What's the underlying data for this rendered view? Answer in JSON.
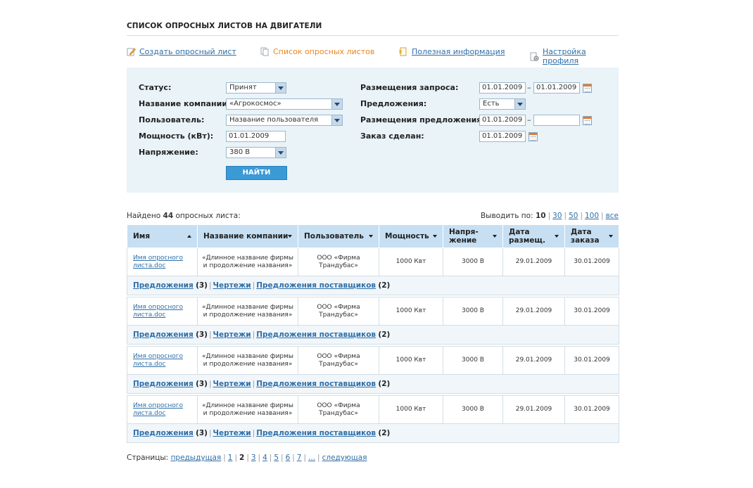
{
  "page_title": "СПИСОК ОПРОСНЫХ ЛИСТОВ НА ДВИГАТЕЛИ",
  "nav": [
    {
      "label": "Создать опросный лист",
      "icon": "pencil-icon",
      "active": false
    },
    {
      "label": "Список опросных листов",
      "icon": "documents-icon",
      "active": true
    },
    {
      "label": "Полезная информация",
      "icon": "info-doc-icon",
      "active": false
    },
    {
      "label": "Настройка профиля",
      "icon": "settings-doc-icon",
      "active": false
    }
  ],
  "filters": {
    "status_label": "Статус:",
    "status_value": "Принят",
    "company_label": "Название компании:",
    "company_value": "«Агрокосмос»",
    "user_label": "Пользователь:",
    "user_value": "Название пользователя",
    "power_label": "Мощность (кВт):",
    "power_value": "01.01.2009",
    "voltage_label": "Напряжение:",
    "voltage_value": "380 В",
    "request_date_label": "Размещения запроса:",
    "request_from": "01.01.2009",
    "request_dash": "–",
    "request_to": "01.01.2009",
    "offers_label": "Предложения:",
    "offers_value": "Есть",
    "offer_date_label": "Размещения предложения:",
    "offer_from": "01.01.2009",
    "offer_dash": "–",
    "offer_to": "",
    "order_label": "Заказ сделан:",
    "order_value": "01.01.2009",
    "search_button": "НАЙТИ"
  },
  "results": {
    "found_prefix": "Найдено",
    "found_count": "44",
    "found_suffix": "опросных листа:",
    "per_page_label": "Выводить по:",
    "per_page_current": "10",
    "per_page_options": [
      "30",
      "50",
      "100",
      "все"
    ]
  },
  "table": {
    "headers": [
      "Имя",
      "Название компании",
      "Пользователь",
      "Мощность",
      "Напря-жение",
      "Дата размещ.",
      "Дата заказа"
    ],
    "header_lines": [
      [
        "Имя"
      ],
      [
        "Название компании"
      ],
      [
        "Пользователь"
      ],
      [
        "Мощность"
      ],
      [
        "Напря-",
        "жение"
      ],
      [
        "Дата",
        "размещ."
      ],
      [
        "Дата",
        "заказа"
      ]
    ],
    "rows": [
      {
        "name": "Имя опросного листа.doc",
        "company": "«Длинное название фирмы и продолжение названия»",
        "user": "ООО «Фирма Трандубас»",
        "power": "1000 Квт",
        "voltage": "3000 В",
        "placed": "29.01.2009",
        "ordered": "30.01.2009",
        "offers_label": "Предложения",
        "offers_count": "(3)",
        "drawings_label": "Чертежи",
        "suppliers_label": "Предложения поставщиков",
        "suppliers_count": "(2)"
      },
      {
        "name": "Имя опросного листа.doc",
        "company": "«Длинное название фирмы и продолжение названия»",
        "user": "ООО «Фирма Трандубас»",
        "power": "1000 Квт",
        "voltage": "3000 В",
        "placed": "29.01.2009",
        "ordered": "30.01.2009",
        "offers_label": "Предложения",
        "offers_count": "(3)",
        "drawings_label": "Чертежи",
        "suppliers_label": "Предложения поставщиков",
        "suppliers_count": "(2)"
      },
      {
        "name": "Имя опросного листа.doc",
        "company": "«Длинное название фирмы и продолжение названия»",
        "user": "ООО «Фирма Трандубас»",
        "power": "1000 Квт",
        "voltage": "3000 В",
        "placed": "29.01.2009",
        "ordered": "30.01.2009",
        "offers_label": "Предложения",
        "offers_count": "(3)",
        "drawings_label": "Чертежи",
        "suppliers_label": "Предложения поставщиков",
        "suppliers_count": "(2)"
      },
      {
        "name": "Имя опросного листа.doc",
        "company": "«Длинное название фирмы и продолжение названия»",
        "user": "ООО «Фирма Трандубас»",
        "power": "1000 Квт",
        "voltage": "3000 В",
        "placed": "29.01.2009",
        "ordered": "30.01.2009",
        "offers_label": "Предложения",
        "offers_count": "(3)",
        "drawings_label": "Чертежи",
        "suppliers_label": "Предложения поставщиков",
        "suppliers_count": "(2)"
      }
    ]
  },
  "pager": {
    "label": "Страницы:",
    "prev": "предыдущая",
    "pages": [
      "1",
      "2",
      "3",
      "4",
      "5",
      "6",
      "7",
      "..."
    ],
    "current": "2",
    "next": "следующая"
  },
  "colors": {
    "link": "#2f6fa8",
    "active_nav": "#e8861e",
    "filter_bg": "#e9f3f8",
    "header_bg": "#c6dff3",
    "button": "#3a9ad6"
  }
}
